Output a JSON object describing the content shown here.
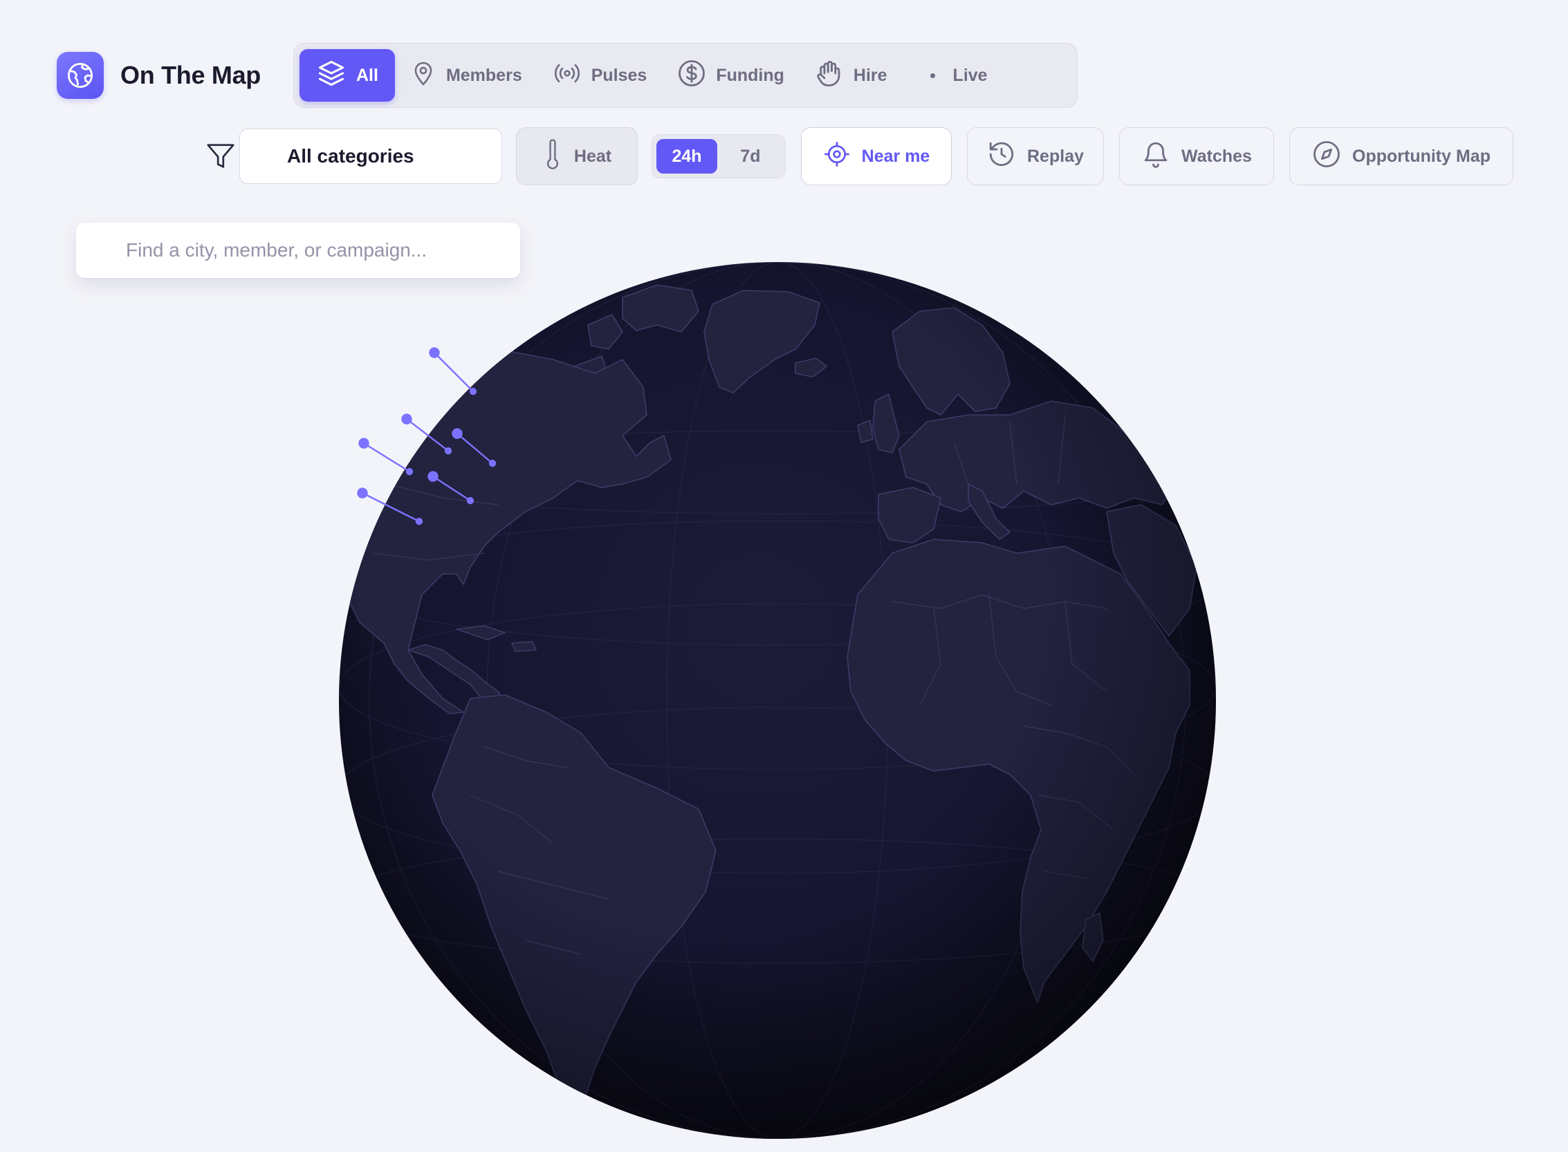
{
  "brand": {
    "title": "On The Map",
    "logo_icon": "globe-icon"
  },
  "modes": {
    "items": [
      {
        "label": "All",
        "icon": "layers-icon",
        "active": true
      },
      {
        "label": "Members",
        "icon": "map-pin-icon",
        "active": false
      },
      {
        "label": "Pulses",
        "icon": "broadcast-icon",
        "active": false
      },
      {
        "label": "Funding",
        "icon": "dollar-icon",
        "active": false
      },
      {
        "label": "Hire",
        "icon": "hand-icon",
        "active": false
      },
      {
        "label": "Live",
        "icon": "dot-icon",
        "active": false
      }
    ]
  },
  "filters": {
    "category_value": "All categories",
    "heat_label": "Heat",
    "range": {
      "options": [
        "24h",
        "7d"
      ],
      "selected": "24h"
    },
    "near_me_label": "Near me",
    "replay_label": "Replay",
    "watches_label": "Watches",
    "opportunity_label": "Opportunity Map"
  },
  "search": {
    "placeholder": "Find a city, member, or campaign..."
  },
  "globe": {
    "markers": [
      {
        "lat": 48.4,
        "lon": -71.1
      },
      {
        "lat": 43.7,
        "lon": -79.4
      },
      {
        "lat": 42.4,
        "lon": -71.1
      },
      {
        "lat": 40.7,
        "lon": -74.0
      },
      {
        "lat": 41.9,
        "lon": -87.6
      },
      {
        "lat": 37.8,
        "lon": -79.0
      }
    ]
  },
  "colors": {
    "accent": "#6258f5",
    "globe_ocean": "#14132a",
    "globe_land": "#23223f",
    "marker": "#7b72ff",
    "background": "#f3f4f9"
  }
}
